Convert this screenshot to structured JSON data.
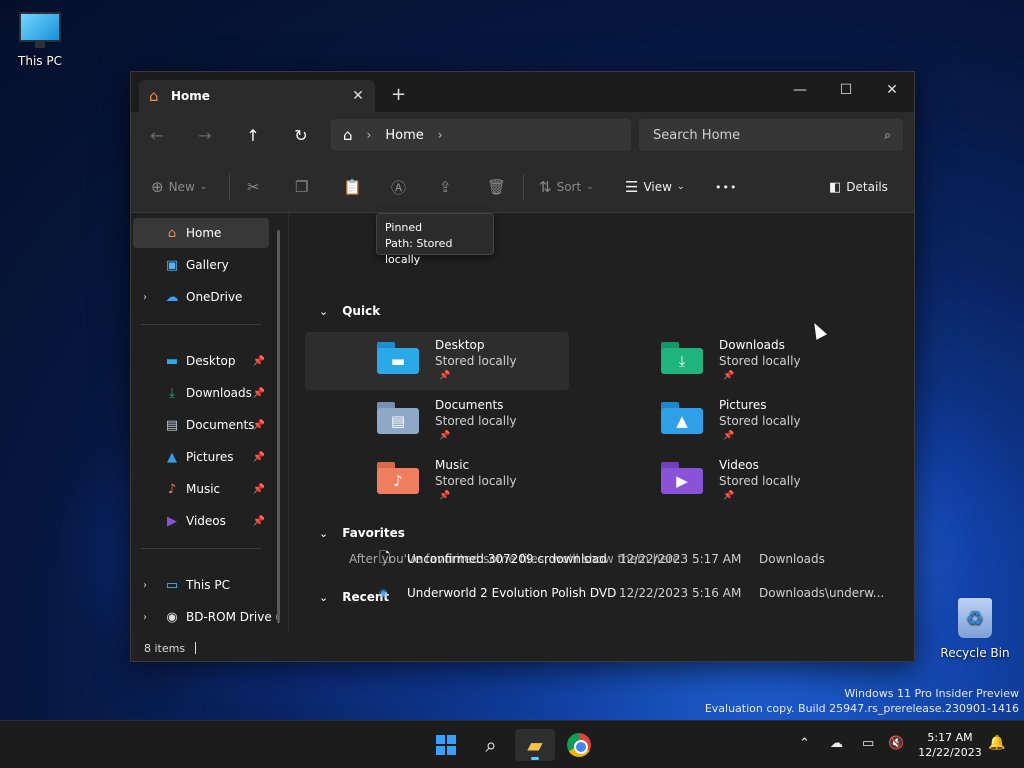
{
  "desktop": {
    "this_pc": "This PC",
    "recycle_bin": "Recycle Bin",
    "watermark_line1": "Windows 11 Pro Insider Preview",
    "watermark_line2": "Evaluation copy. Build 25947.rs_prerelease.230901-1416"
  },
  "window": {
    "tab_title": "Home",
    "tab_close": "✕",
    "new_tab": "+",
    "minimize": "—",
    "maximize": "☐",
    "close": "✕"
  },
  "address_bar": {
    "crumb": "Home",
    "search_placeholder": "Search Home"
  },
  "commands": {
    "new": "New",
    "sort": "Sort",
    "view": "View",
    "more": "•••",
    "details": "Details"
  },
  "sidebar": {
    "top": [
      {
        "label": "Home",
        "icon": "home-icon",
        "selected": true
      },
      {
        "label": "Gallery",
        "icon": "gallery-icon"
      },
      {
        "label": "OneDrive",
        "icon": "cloud-icon",
        "expandable": true
      }
    ],
    "pinned": [
      {
        "label": "Desktop",
        "icon": "desktop-icon"
      },
      {
        "label": "Downloads",
        "icon": "download-icon"
      },
      {
        "label": "Documents",
        "icon": "documents-icon"
      },
      {
        "label": "Pictures",
        "icon": "pictures-icon"
      },
      {
        "label": "Music",
        "icon": "music-icon"
      },
      {
        "label": "Videos",
        "icon": "videos-icon"
      }
    ],
    "drives": [
      {
        "label": "This PC",
        "icon": "pc-icon"
      },
      {
        "label": "BD-ROM Drive (",
        "icon": "disc-icon"
      }
    ]
  },
  "content": {
    "quick_access_label": "Quick",
    "tooltip_title": "Pinned",
    "tooltip_path": "Path: Stored locally",
    "folders": [
      {
        "name": "Desktop",
        "sub": "Stored locally",
        "color": "#2aa8e8",
        "icon": "desktop-folder-icon"
      },
      {
        "name": "Downloads",
        "sub": "Stored locally",
        "color": "#1fb37e",
        "icon": "downloads-folder-icon"
      },
      {
        "name": "Documents",
        "sub": "Stored locally",
        "color": "#8fa8c8",
        "icon": "documents-folder-icon"
      },
      {
        "name": "Pictures",
        "sub": "Stored locally",
        "color": "#2f9fe8",
        "icon": "pictures-folder-icon"
      },
      {
        "name": "Music",
        "sub": "Stored locally",
        "color": "#f07f5f",
        "icon": "music-folder-icon"
      },
      {
        "name": "Videos",
        "sub": "Stored locally",
        "color": "#8a52d6",
        "icon": "videos-folder-icon"
      }
    ],
    "favorites_label": "Favorites",
    "favorites_empty": "After you've favorited some files, we'll show them here.",
    "recent_label": "Recent",
    "recent": [
      {
        "name": "Unconfirmed 307209.crdownload",
        "date": "12/22/2023 5:17 AM",
        "location": "Downloads"
      },
      {
        "name": "Underworld 2 Evolution Polish DVD",
        "date": "12/22/2023 5:16 AM",
        "location": "Downloads\\underw..."
      }
    ]
  },
  "status": {
    "items": "8 items"
  },
  "taskbar": {
    "time": "5:17 AM",
    "date": "12/22/2023"
  }
}
